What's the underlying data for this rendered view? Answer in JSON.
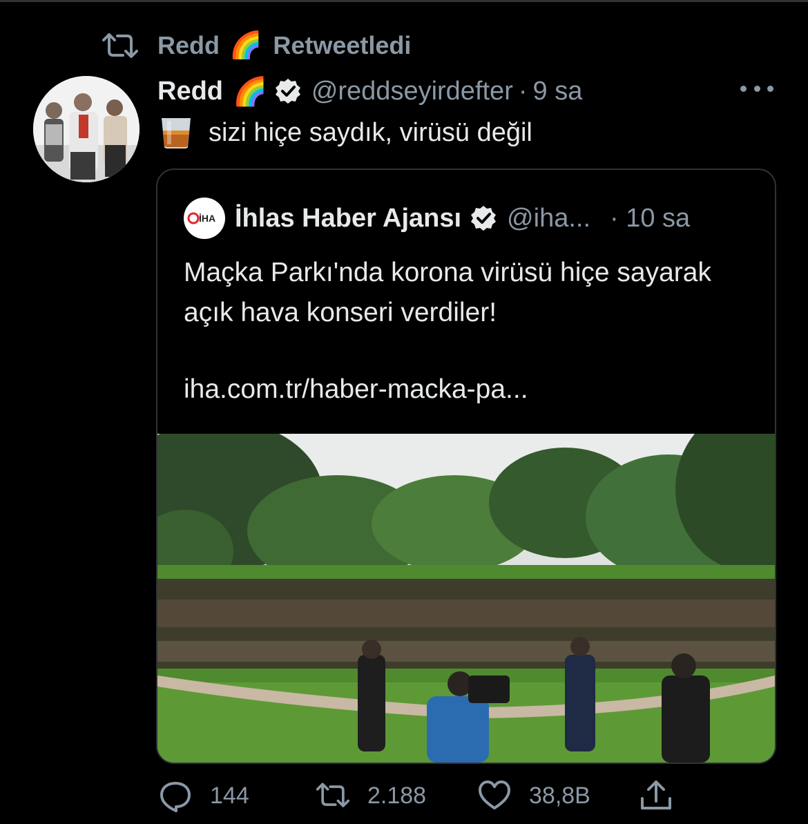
{
  "retweet": {
    "user": "Redd",
    "emoji": "🌈",
    "label": "Retweetledi"
  },
  "tweet": {
    "name": "Redd",
    "emoji": "🌈",
    "handle": "@reddseyirdefter",
    "separator": "·",
    "time": "9 sa",
    "text": "sizi hiçe saydık, virüsü değil",
    "text_icon": "whiskey-glass-icon"
  },
  "quote": {
    "logo_text": "İHA",
    "name": "İhlas Haber Ajansı",
    "handle": "@iha...",
    "time": "· 10 sa",
    "text": "Maçka Parkı'nda korona virüsü hiçe sayarak açık hava konseri verdiler!",
    "link": "iha.com.tr/haber-macka-pa..."
  },
  "actions": {
    "reply_count": "144",
    "retweet_count": "2.188",
    "like_count": "38,8B"
  },
  "colors": {
    "background": "#000000",
    "text": "#e7e9ea",
    "muted": "#8b98a5",
    "border": "#2f3336"
  }
}
